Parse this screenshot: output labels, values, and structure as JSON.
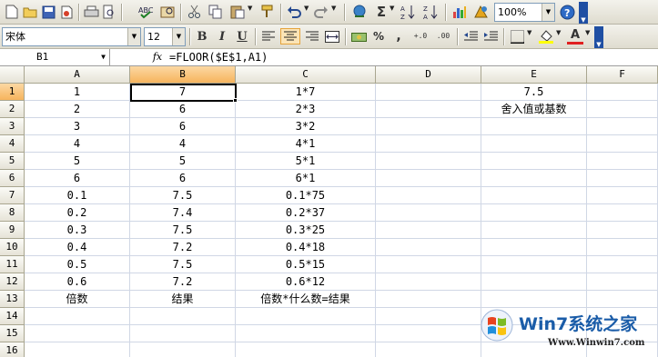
{
  "toolbar_standard": {
    "zoom": "100%",
    "icons": [
      "new-icon",
      "open-icon",
      "save-icon",
      "permission-icon",
      "print-icon",
      "print-preview-icon",
      "spelling-icon",
      "research-icon",
      "cut-icon",
      "copy-icon",
      "paste-icon",
      "format-painter-icon",
      "undo-icon",
      "redo-icon",
      "hyperlink-icon",
      "autosum-icon",
      "sort-ascending-icon",
      "sort-descending-icon",
      "chart-wizard-icon",
      "drawing-icon",
      "help-icon"
    ],
    "sum_glyph": "Σ"
  },
  "toolbar_formatting": {
    "font_name": "宋体",
    "font_size": "12",
    "bold": "B",
    "italic": "I",
    "underline": "U",
    "percent": "%",
    "comma": ",",
    "increase_decimal": "+.0",
    "decrease_decimal": ".00",
    "font_color_glyph": "A"
  },
  "formula_bar": {
    "name_box": "B1",
    "fx": "fx",
    "formula": "=FLOOR($E$1,A1)"
  },
  "sheet": {
    "columns": [
      "A",
      "B",
      "C",
      "D",
      "E",
      "F"
    ],
    "selected_column": "B",
    "selected_row": "1",
    "rows": [
      {
        "n": "1",
        "a": "1",
        "b": "7",
        "c": "1*7",
        "d": "",
        "e": "7.5",
        "f": ""
      },
      {
        "n": "2",
        "a": "2",
        "b": "6",
        "c": "2*3",
        "d": "",
        "e": "舍入值或基数",
        "f": ""
      },
      {
        "n": "3",
        "a": "3",
        "b": "6",
        "c": "3*2",
        "d": "",
        "e": "",
        "f": ""
      },
      {
        "n": "4",
        "a": "4",
        "b": "4",
        "c": "4*1",
        "d": "",
        "e": "",
        "f": ""
      },
      {
        "n": "5",
        "a": "5",
        "b": "5",
        "c": "5*1",
        "d": "",
        "e": "",
        "f": ""
      },
      {
        "n": "6",
        "a": "6",
        "b": "6",
        "c": "6*1",
        "d": "",
        "e": "",
        "f": ""
      },
      {
        "n": "7",
        "a": "0.1",
        "b": "7.5",
        "c": "0.1*75",
        "d": "",
        "e": "",
        "f": ""
      },
      {
        "n": "8",
        "a": "0.2",
        "b": "7.4",
        "c": "0.2*37",
        "d": "",
        "e": "",
        "f": ""
      },
      {
        "n": "9",
        "a": "0.3",
        "b": "7.5",
        "c": "0.3*25",
        "d": "",
        "e": "",
        "f": ""
      },
      {
        "n": "10",
        "a": "0.4",
        "b": "7.2",
        "c": "0.4*18",
        "d": "",
        "e": "",
        "f": ""
      },
      {
        "n": "11",
        "a": "0.5",
        "b": "7.5",
        "c": "0.5*15",
        "d": "",
        "e": "",
        "f": ""
      },
      {
        "n": "12",
        "a": "0.6",
        "b": "7.2",
        "c": "0.6*12",
        "d": "",
        "e": "",
        "f": ""
      },
      {
        "n": "13",
        "a": "倍数",
        "b": "结果",
        "c": "倍数*什么数=结果",
        "d": "",
        "e": "",
        "f": ""
      },
      {
        "n": "14",
        "a": "",
        "b": "",
        "c": "",
        "d": "",
        "e": "",
        "f": ""
      },
      {
        "n": "15",
        "a": "",
        "b": "",
        "c": "",
        "d": "",
        "e": "",
        "f": ""
      },
      {
        "n": "16",
        "a": "",
        "b": "",
        "c": "",
        "d": "",
        "e": "",
        "f": ""
      }
    ]
  },
  "watermark": {
    "brand": "Win7系统之家",
    "url": "Www.Winwin7.com"
  }
}
